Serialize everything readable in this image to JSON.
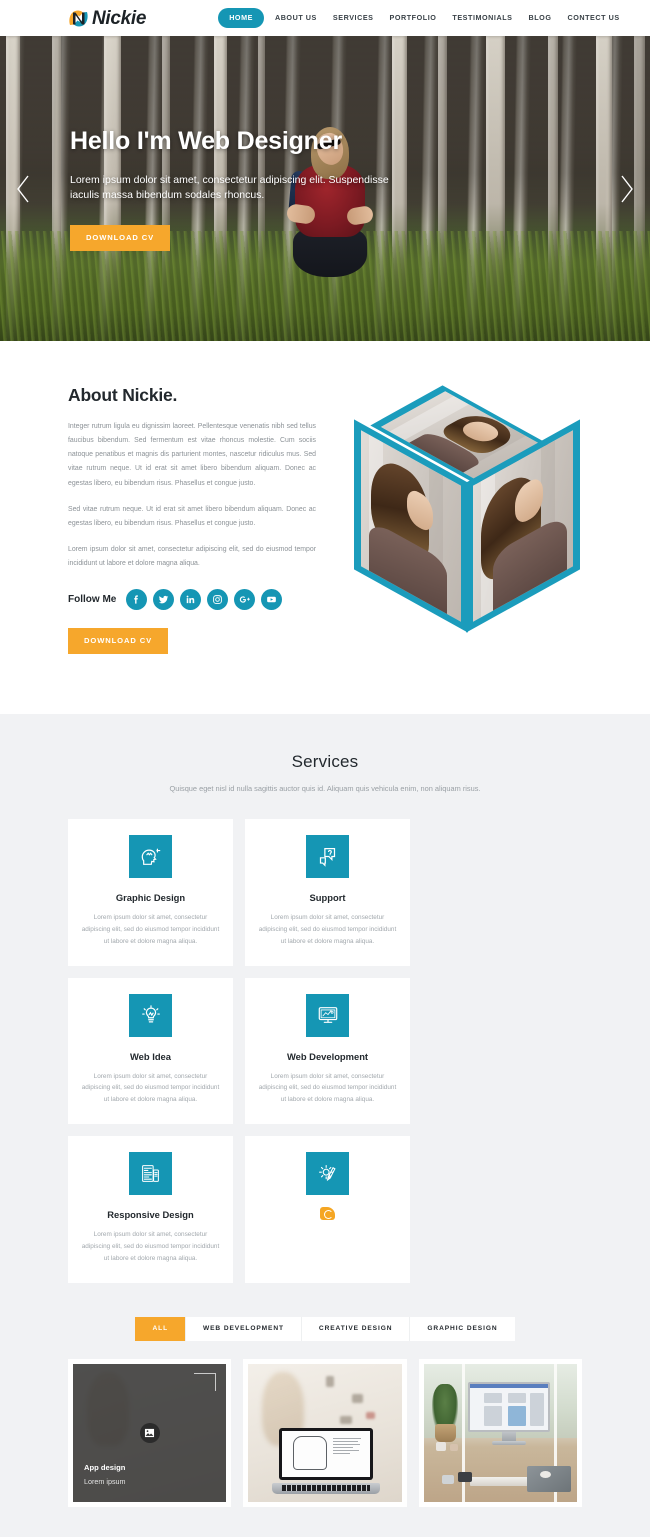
{
  "brand": {
    "name": "Nickie",
    "logo_icon": "nickie-n-logo",
    "teal": "#1596b4",
    "orange": "#f6a72c"
  },
  "nav": {
    "items": [
      {
        "label": "HOME",
        "active": true
      },
      {
        "label": "ABOUT US",
        "active": false
      },
      {
        "label": "SERVICES",
        "active": false
      },
      {
        "label": "PORTFOLIO",
        "active": false
      },
      {
        "label": "TESTIMONIALS",
        "active": false
      },
      {
        "label": "BLOG",
        "active": false
      },
      {
        "label": "CONTECT US",
        "active": false
      }
    ]
  },
  "hero": {
    "title": "Hello I'm Web Designer",
    "subtitle": "Lorem ipsum dolor sit amet, consectetur adipiscing elit. Suspendisse iaculis massa bibendum sodales rhoncus.",
    "button": "DOWNLOAD CV",
    "prev_icon": "chevron-left-icon",
    "next_icon": "chevron-right-icon"
  },
  "about": {
    "title": "About Nickie.",
    "paragraph1": "Integer rutrum ligula eu dignissim laoreet. Pellentesque venenatis nibh sed tellus faucibus bibendum. Sed fermentum est vitae rhoncus molestie. Cum sociis natoque penatibus et magnis dis parturient montes, nascetur ridiculus mus. Sed vitae rutrum neque. Ut id erat sit amet libero bibendum aliquam. Donec ac egestas libero, eu bibendum risus. Phasellus et congue justo.",
    "paragraph2": "Sed vitae rutrum neque. Ut id erat sit amet libero bibendum aliquam. Donec ac egestas libero, eu bibendum risus. Phasellus et congue justo.",
    "paragraph3": "Lorem ipsum dolor sit amet, consectetur adipiscing elit, sed do eiusmod tempor incididunt ut labore et dolore magna aliqua.",
    "follow_label": "Follow Me",
    "button": "DOWNLOAD CV",
    "social": [
      {
        "name": "facebook-icon"
      },
      {
        "name": "twitter-icon"
      },
      {
        "name": "linkedin-icon"
      },
      {
        "name": "instagram-icon"
      },
      {
        "name": "googleplus-icon"
      },
      {
        "name": "youtube-icon"
      }
    ],
    "cube_alt": "portrait-cube-image"
  },
  "services": {
    "title": "Services",
    "subtitle": "Quisque eget nisl id nulla sagittis auctor quis id. Aliquam quis vehicula enim, non aliquam risus.",
    "common_desc": "Lorem ipsum dolor sit amet, consectetur adipiscing elit, sed do eiusmod tempor incididunt ut labore et dolore magna aliqua.",
    "cards": [
      {
        "title": "Graphic Design",
        "icon": "head-idea-icon",
        "has_title": true
      },
      {
        "title": "Support",
        "icon": "chat-support-icon",
        "has_title": true
      },
      {
        "title": "Web Idea",
        "icon": "lightbulb-idea-icon",
        "has_title": true
      },
      {
        "title": "Web Development",
        "icon": "monitor-code-icon",
        "has_title": true
      },
      {
        "title": "Responsive Design",
        "icon": "responsive-layout-icon",
        "has_title": true
      },
      {
        "title": "",
        "icon": "gear-tool-icon",
        "has_title": false,
        "broken_glyph": "broken-image-glyph"
      }
    ]
  },
  "portfolio": {
    "filters": [
      {
        "label": "ALL",
        "active": true
      },
      {
        "label": "WEB DEVELOPMENT",
        "active": false
      },
      {
        "label": "CREATIVE DESIGN",
        "active": false
      },
      {
        "label": "GRAPHIC DESIGN",
        "active": false
      }
    ],
    "items": [
      {
        "title": "App design",
        "subtitle": "Lorem ipsum",
        "overlay": true,
        "zoom_icon": "image-icon",
        "alt": "app-design-thumbnail"
      },
      {
        "title": "",
        "subtitle": "",
        "overlay": false,
        "alt": "laptop-fashion-sketch-thumbnail"
      },
      {
        "title": "",
        "subtitle": "",
        "overlay": false,
        "alt": "imac-desk-thumbnail"
      }
    ]
  }
}
